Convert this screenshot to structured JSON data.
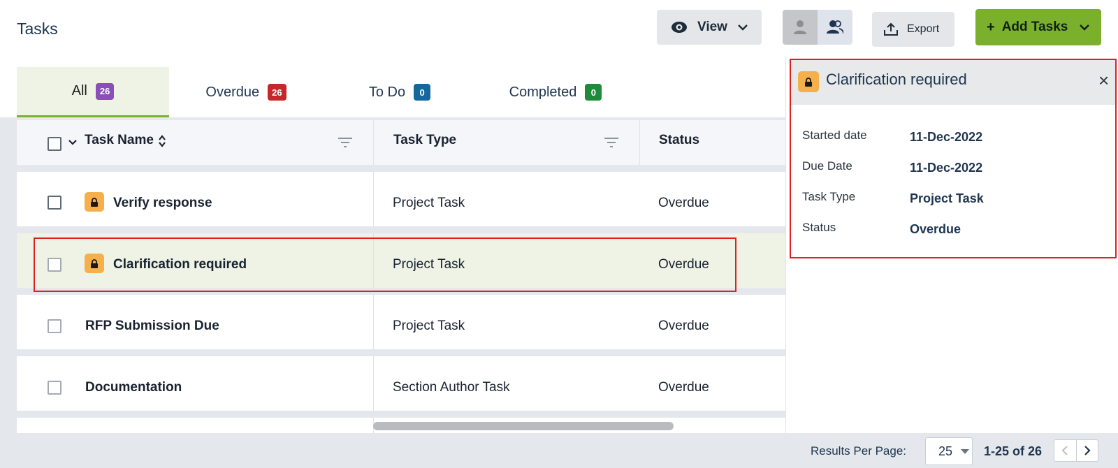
{
  "header": {
    "title": "Tasks",
    "view_label": "View",
    "export_label": "Export",
    "add_label": "Add Tasks",
    "add_plus": "+"
  },
  "tabs": [
    {
      "label": "All",
      "count": "26",
      "badge_color": "#8a4fb8"
    },
    {
      "label": "Overdue",
      "count": "26",
      "badge_color": "#c8262a"
    },
    {
      "label": "To Do",
      "count": "0",
      "badge_color": "#16689c"
    },
    {
      "label": "Completed",
      "count": "0",
      "badge_color": "#1e8a3c"
    }
  ],
  "grid": {
    "columns": {
      "task_name": "Task Name",
      "task_type": "Task Type",
      "status": "Status"
    },
    "rows": [
      {
        "name": "Verify response",
        "type": "Project Task",
        "status": "Overdue",
        "locked": true
      },
      {
        "name": "Clarification required",
        "type": "Project Task",
        "status": "Overdue",
        "locked": true,
        "selected": true
      },
      {
        "name": "RFP Submission Due",
        "type": "Project Task",
        "status": "Overdue",
        "locked": false
      },
      {
        "name": "Documentation",
        "type": "Section Author Task",
        "status": "Overdue",
        "locked": false
      }
    ]
  },
  "detail": {
    "title": "Clarification required",
    "close": "×",
    "fields": [
      {
        "label": "Started date",
        "value": "11-Dec-2022"
      },
      {
        "label": "Due Date",
        "value": "11-Dec-2022"
      },
      {
        "label": "Task Type",
        "value": "Project Task"
      },
      {
        "label": "Status",
        "value": "Overdue"
      }
    ]
  },
  "footer": {
    "results_label": "Results Per Page:",
    "per_page": "25",
    "range": "1-25 of 26"
  },
  "colors": {
    "accent_green": "#7ab02c",
    "selected_row": "#eef3e6",
    "lock_orange": "#f6b04b",
    "highlight_red": "#e02020"
  }
}
